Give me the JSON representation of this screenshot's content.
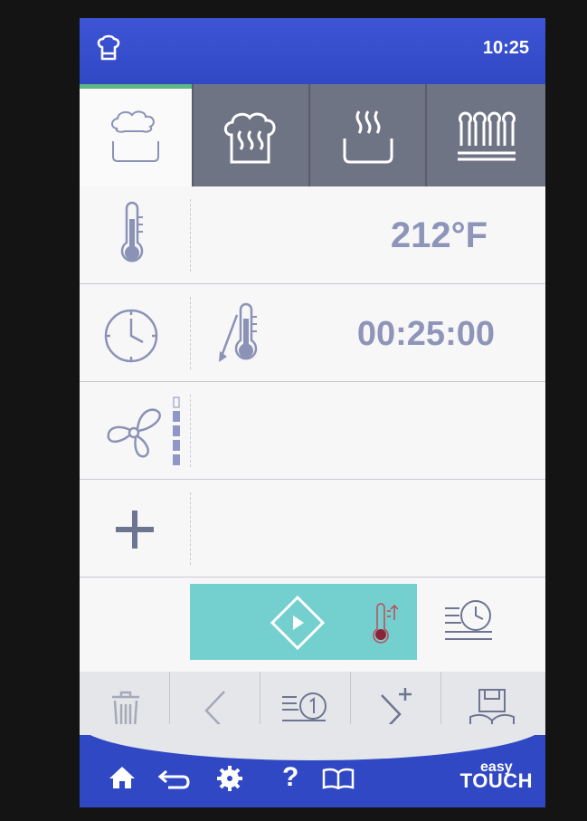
{
  "status_bar": {
    "time": "10:25",
    "profile_icon": "chef-hat-icon"
  },
  "mode_tabs": [
    {
      "name": "convection-icon",
      "active": true
    },
    {
      "name": "combi-steam-icon",
      "active": false
    },
    {
      "name": "steam-icon",
      "active": false
    },
    {
      "name": "hot-air-grill-icon",
      "active": false
    }
  ],
  "temperature": {
    "value": "212°F",
    "icon": "thermometer-icon"
  },
  "time_setting": {
    "value": "00:25:00",
    "icon": "clock-icon",
    "probe_icon": "core-probe-icon"
  },
  "fan": {
    "icon": "fan-icon",
    "level_of": 5,
    "level": 4
  },
  "add_step": {
    "icon": "plus-icon"
  },
  "start": {
    "icon": "start-icon",
    "preheat_icon": "preheat-thermometer-icon",
    "delay_icon": "delayed-start-icon"
  },
  "toolbar": [
    "trash-icon",
    "back-chevron-icon",
    "step-list-icon",
    "next-step-icon",
    "save-recipe-icon"
  ],
  "bottom_nav": [
    "home-icon",
    "return-icon",
    "settings-gear-icon",
    "help-icon",
    "cookbook-icon"
  ],
  "brand": {
    "line1": "easy",
    "line2": "TOUCH"
  },
  "colors": {
    "accent_blue": "#3148c4",
    "start_teal": "#74cfcf",
    "active_tab_green": "#5fb884",
    "value_text": "#8e95b8"
  }
}
